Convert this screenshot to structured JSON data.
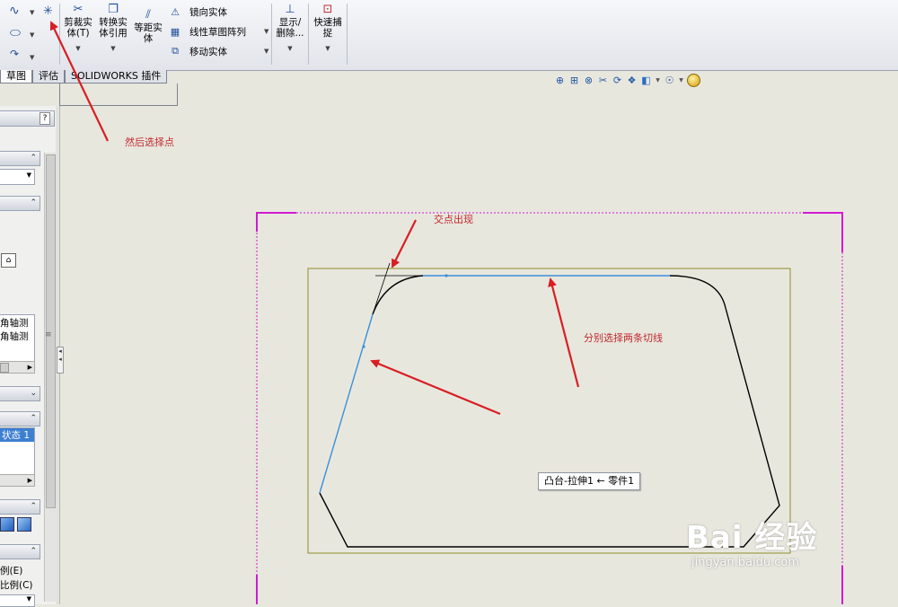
{
  "toolbar": {
    "trim_label": "剪裁实\n体(T)",
    "convert_label": "转换实\n体引用",
    "offset_label": "等距实\n体",
    "mirror_label": "镜向实体",
    "linear_pattern_label": "线性草图阵列",
    "move_label": "移动实体",
    "display_delete_label": "显示/\n删除...",
    "quick_snap_label": "快速捕\n捉"
  },
  "tabs": [
    {
      "label": "草图",
      "active": true
    },
    {
      "label": "评估",
      "active": false
    },
    {
      "label": "SOLIDWORKS 插件",
      "active": false
    }
  ],
  "left_panel": {
    "help_label": "?",
    "axis_line1": "角轴测",
    "axis_line2": "角轴测",
    "state_item": "状态 1",
    "scale_option1": "例(E)",
    "scale_option2": "比例(C)"
  },
  "annotations": {
    "select_point": "然后选择点",
    "intersection": "交点出现",
    "tangent_lines": "分别选择两条切线"
  },
  "tooltip": "凸台-拉伸1 ← 零件1",
  "watermark": {
    "main": "Bai 经验",
    "sub": "jingyan.baidu.com"
  },
  "colors": {
    "annotation_red": "#c0282d",
    "selected_line_blue": "#3b8fd9",
    "sketch_black": "#000000",
    "bounding_box_olive": "#8c8c2a",
    "plane_magenta": "#d11ad1"
  }
}
